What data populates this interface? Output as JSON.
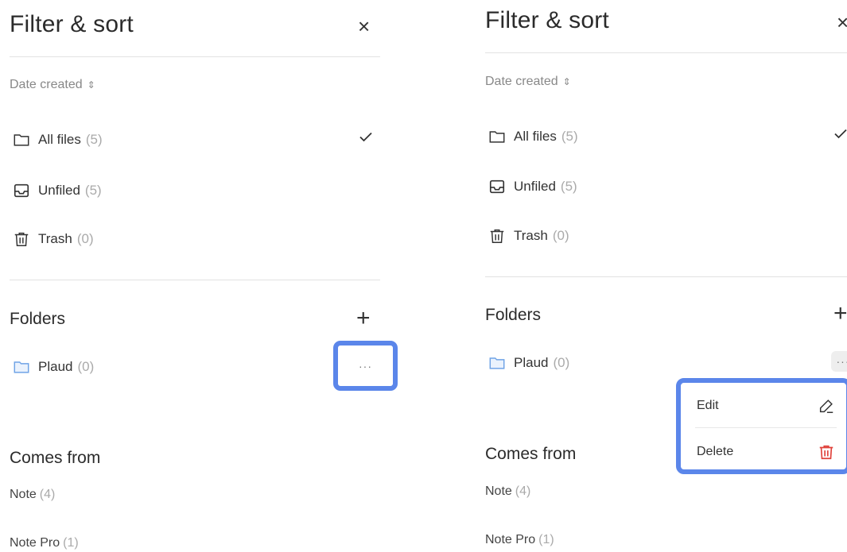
{
  "left": {
    "title": "Filter & sort",
    "close": "×",
    "sort_label": "Date created",
    "sort_icon": "⇕",
    "items": [
      {
        "label": "All files",
        "count": "(5)",
        "icon": "folder-icon",
        "selected": true
      },
      {
        "label": "Unfiled",
        "count": "(5)",
        "icon": "inbox-icon",
        "selected": false
      },
      {
        "label": "Trash",
        "count": "(0)",
        "icon": "trash-icon",
        "selected": false
      }
    ],
    "check": "✓",
    "folders_title": "Folders",
    "add": "+",
    "folder": {
      "label": "Plaud",
      "count": "(0)",
      "more": "···"
    },
    "comes_from_title": "Comes from",
    "sources": [
      {
        "label": "Note",
        "count": "(4)"
      },
      {
        "label": "Note Pro",
        "count": "(1)"
      }
    ]
  },
  "right": {
    "title": "Filter & sort",
    "close": "×",
    "sort_label": "Date created",
    "sort_icon": "⇕",
    "items": [
      {
        "label": "All files",
        "count": "(5)",
        "icon": "folder-icon",
        "selected": true
      },
      {
        "label": "Unfiled",
        "count": "(5)",
        "icon": "inbox-icon",
        "selected": false
      },
      {
        "label": "Trash",
        "count": "(0)",
        "icon": "trash-icon",
        "selected": false
      }
    ],
    "check": "✓",
    "folders_title": "Folders",
    "add": "+",
    "folder": {
      "label": "Plaud",
      "count": "(0)",
      "more": "···"
    },
    "menu": {
      "edit_label": "Edit",
      "edit_icon": "pencil-icon",
      "delete_label": "Delete",
      "delete_icon": "trash-icon"
    },
    "comes_from_title": "Comes from",
    "sources": [
      {
        "label": "Note",
        "count": "(4)"
      },
      {
        "label": "Note Pro",
        "count": "(1)"
      }
    ]
  },
  "colors": {
    "highlight": "#5b86ea",
    "folder_blue": "#6fa3e6",
    "delete_red": "#e0413a",
    "muted": "#aaaaaa"
  }
}
